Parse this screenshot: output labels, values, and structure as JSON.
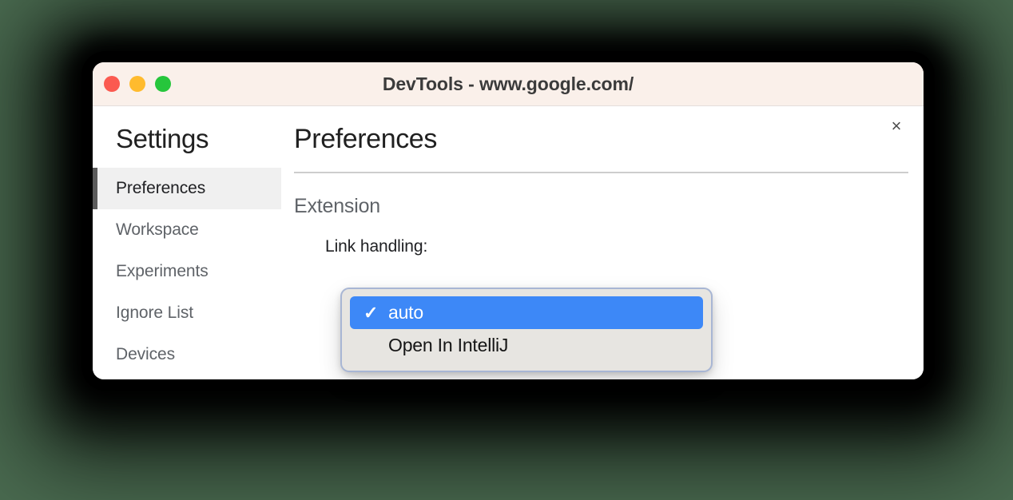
{
  "window": {
    "title": "DevTools - www.google.com/",
    "traffic_lights": [
      {
        "name": "close",
        "color": "#fb5a50"
      },
      {
        "name": "minimize",
        "color": "#ffbb2e"
      },
      {
        "name": "maximize",
        "color": "#26c63c"
      }
    ],
    "close_icon": "×"
  },
  "sidebar": {
    "title": "Settings",
    "items": [
      {
        "label": "Preferences",
        "selected": true
      },
      {
        "label": "Workspace",
        "selected": false
      },
      {
        "label": "Experiments",
        "selected": false
      },
      {
        "label": "Ignore List",
        "selected": false
      },
      {
        "label": "Devices",
        "selected": false
      }
    ]
  },
  "content": {
    "page_title": "Preferences",
    "section_title": "Extension",
    "field_label": "Link handling:"
  },
  "select_popup": {
    "options": [
      {
        "label": "auto",
        "selected": true,
        "check": "✓"
      },
      {
        "label": "Open In IntelliJ",
        "selected": false,
        "check": "✓"
      }
    ]
  },
  "colors": {
    "background": "#4a6b50",
    "titlebar": "#faf0ea",
    "accent_blue": "#3d88f7",
    "selected_item_bg": "#f0f0f0",
    "selected_item_bar": "#5b5b5b",
    "popup_bg": "#e7e5e1"
  }
}
